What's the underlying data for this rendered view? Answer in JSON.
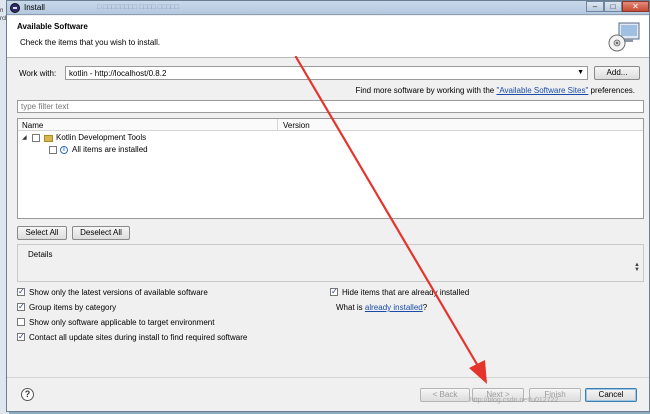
{
  "background": {
    "strip_texts": [
      "n",
      "rch"
    ]
  },
  "window": {
    "title": "Install",
    "title_blur": "□ □□□□□□□□ □□□□ □□□□□",
    "minimize": "–",
    "maximize": "□",
    "close": "✕"
  },
  "banner": {
    "title": "Available Software",
    "subtitle": "Check the items that you wish to install."
  },
  "work_with": {
    "label": "Work with:",
    "value": "kotlin - http://localhost/0.8.2",
    "add_button": "Add..."
  },
  "find_more": {
    "prefix": "Find more software by working with the ",
    "link": "\"Available Software Sites\"",
    "suffix": " preferences."
  },
  "filter": {
    "placeholder": "type filter text"
  },
  "table": {
    "col_name": "Name",
    "col_version": "Version",
    "rows": [
      {
        "label": "Kotlin Development Tools",
        "checked": false,
        "type": "category"
      },
      {
        "label": "All items are installed",
        "checked": false,
        "type": "info"
      }
    ]
  },
  "selection": {
    "select_all": "Select All",
    "deselect_all": "Deselect All"
  },
  "details": {
    "label": "Details"
  },
  "options": {
    "latest_versions": {
      "label": "Show only the latest versions of available software",
      "checked": true
    },
    "group_items": {
      "label": "Group items by category",
      "checked": true
    },
    "applicable_only": {
      "label": "Show only software applicable to target environment",
      "checked": false
    },
    "contact_sites": {
      "label": "Contact all update sites during install to find required software",
      "checked": true
    },
    "hide_installed": {
      "label": "Hide items that are already installed",
      "checked": true
    },
    "what_is_prefix": "What is ",
    "what_is_link": "already installed",
    "what_is_suffix": "?"
  },
  "footer": {
    "help": "?",
    "back": "< Back",
    "next": "Next >",
    "finish": "Finish",
    "cancel": "Cancel"
  },
  "watermark": "http://blog.csdn.net/u012722"
}
